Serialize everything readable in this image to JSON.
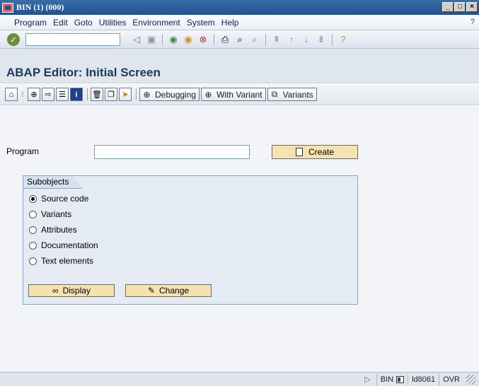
{
  "window": {
    "title": "BIN (1) (000)",
    "controls": [
      "_",
      "□",
      "×"
    ]
  },
  "menu": {
    "items": [
      "Program",
      "Edit",
      "Goto",
      "Utilities",
      "Environment",
      "System",
      "Help"
    ],
    "help_char": "?"
  },
  "std_toolbar": {
    "enter_icon": "checkmark-icon",
    "icons": [
      "back-icon",
      "save-icon",
      "navigate-back-icon",
      "exit-icon",
      "cancel-icon",
      "print-icon",
      "find-icon",
      "find-next-icon",
      "first-page-icon",
      "previous-page-icon",
      "next-page-icon",
      "last-page-icon",
      "help-icon"
    ]
  },
  "screen": {
    "title": "ABAP Editor: Initial Screen"
  },
  "app_toolbar": {
    "buttons": {
      "debugging": "Debugging",
      "with_variant": "With Variant",
      "variants": "Variants"
    }
  },
  "form": {
    "program_label": "Program",
    "program_value": "",
    "create_label": "Create"
  },
  "subobjects": {
    "title": "Subobjects",
    "options": [
      "Source code",
      "Variants",
      "Attributes",
      "Documentation",
      "Text elements"
    ],
    "selected": "Source code",
    "display_label": "Display",
    "change_label": "Change"
  },
  "status": {
    "system": "BIN",
    "host": "ld8061",
    "mode": "OVR"
  }
}
